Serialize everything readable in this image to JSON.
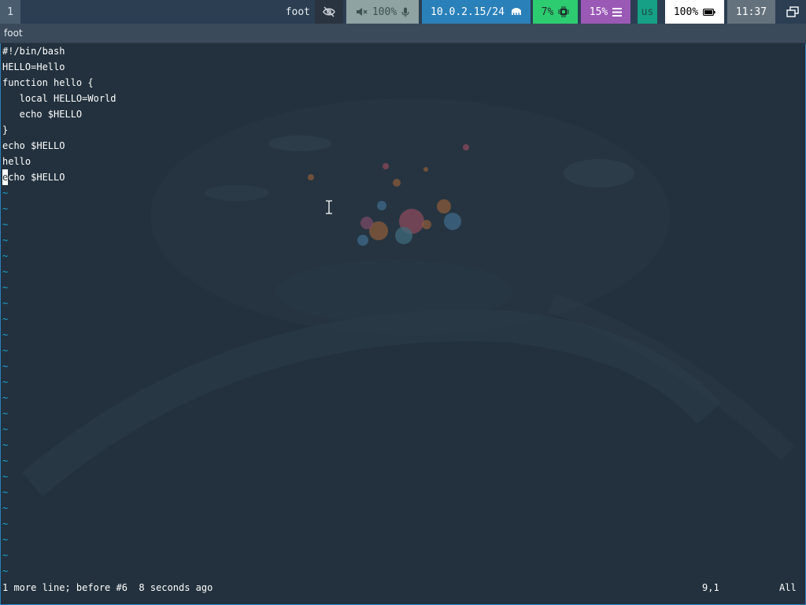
{
  "topbar": {
    "workspace": "1",
    "window_title": "foot",
    "idle_icon": "eye-slash-icon",
    "audio": {
      "icon": "speaker-muted-icon",
      "volume": "100%",
      "mic_icon": "microphone-icon"
    },
    "network": {
      "address": "10.0.2.15/24",
      "icon": "ethernet-icon"
    },
    "cpu": {
      "value": "7%",
      "icon": "cpu-chip-icon"
    },
    "memory": {
      "value": "15%",
      "icon": "memory-bars-icon"
    },
    "language": "us",
    "battery": {
      "value": "100%",
      "icon": "battery-full-icon"
    },
    "clock": "11:37",
    "tray_icon": "windows-stack-icon"
  },
  "window": {
    "title": "foot"
  },
  "editor": {
    "lines": [
      "#!/bin/bash",
      "HELLO=Hello",
      "function hello {",
      "   local HELLO=World",
      "   echo $HELLO",
      "}",
      "echo $HELLO",
      "hello"
    ],
    "cursor_line": {
      "cursor_char": "e",
      "rest": "cho $HELLO"
    },
    "empty_marker": "~",
    "empty_line_count": 25,
    "status_message": "1 more line; before #6  8 seconds ago",
    "cursor_position": "9,1",
    "scroll_position": "All"
  },
  "colors": {
    "topbar_bg": "#2b3e52",
    "terminal_bg": "#22313d",
    "tilde": "#1aa7d9",
    "network": "#2a80b9",
    "cpu": "#2ecc71",
    "memory": "#9b59b6",
    "language": "#16a085"
  }
}
